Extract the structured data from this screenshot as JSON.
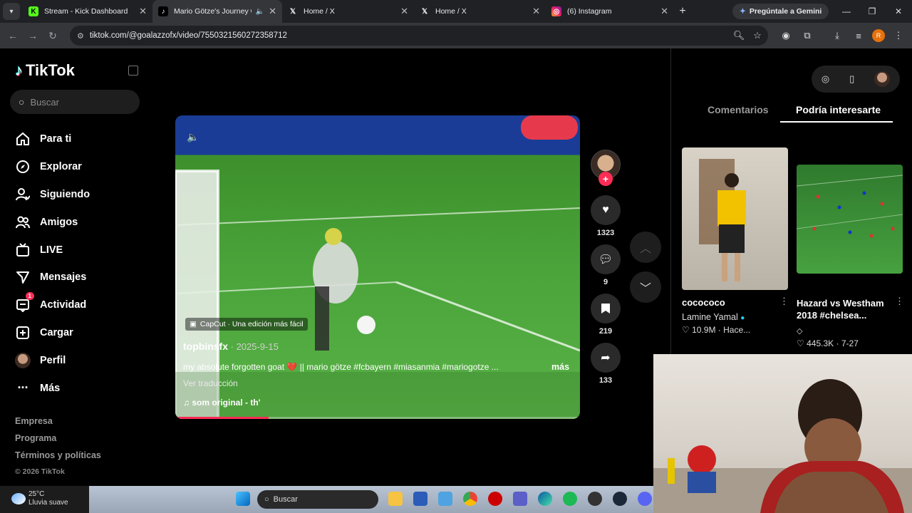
{
  "browser": {
    "tabs": [
      {
        "title": "Stream - Kick Dashboard",
        "icon": "kick-icon"
      },
      {
        "title": "Mario Götze's Journey wit",
        "icon": "tiktok-icon",
        "active": true
      },
      {
        "title": "Home / X",
        "icon": "x-icon"
      },
      {
        "title": "Home / X",
        "icon": "x-icon"
      },
      {
        "title": "(6) Instagram",
        "icon": "instagram-icon"
      }
    ],
    "gemini_label": "Pregúntale a Gemini",
    "url": "tiktok.com/@goalazzofx/video/7550321560272358712",
    "profile_initial": "R"
  },
  "sidebar": {
    "logo": "TikTok",
    "search_placeholder": "Buscar",
    "items": [
      {
        "label": "Para ti",
        "icon": "home-icon"
      },
      {
        "label": "Explorar",
        "icon": "compass-icon"
      },
      {
        "label": "Siguiendo",
        "icon": "following-icon"
      },
      {
        "label": "Amigos",
        "icon": "friends-icon"
      },
      {
        "label": "LIVE",
        "icon": "live-icon"
      },
      {
        "label": "Mensajes",
        "icon": "messages-icon"
      },
      {
        "label": "Actividad",
        "icon": "activity-icon",
        "badge": "1"
      },
      {
        "label": "Cargar",
        "icon": "upload-icon"
      },
      {
        "label": "Perfil",
        "icon": "avatar"
      },
      {
        "label": "Más",
        "icon": "more-icon"
      }
    ],
    "footer": [
      "Empresa",
      "Programa",
      "Términos y políticas"
    ],
    "copyright": "© 2026 TikTok"
  },
  "video": {
    "capcut": "CapCut · Una edición más fácil",
    "author": "topbinsfx",
    "date": "2025-9-15",
    "description": "my absolute forgotten goat 💔 || mario götze #fcbayern #miasanmia #mariogotze ...",
    "more": "más",
    "translate": "Ver traducción",
    "sound": "som original - th'",
    "progress": 0.23
  },
  "actions": {
    "likes": "1323",
    "comments": "9",
    "saves": "219",
    "shares": "133"
  },
  "right_panel": {
    "tab_comments": "Comentarios",
    "tab_interest": "Podría interesarte",
    "cards": [
      {
        "title": "cocococo",
        "author": "Lamine Yamal",
        "verified": true,
        "views": "10.9M",
        "time": "Hace..."
      },
      {
        "title": "Hazard vs Westham 2018 #chelsea...",
        "author": "◇",
        "views": "445.3K",
        "time": "7-27"
      }
    ]
  },
  "taskbar": {
    "temp": "25°C",
    "weather": "Lluvia suave",
    "search": "Buscar"
  },
  "colors": {
    "accent": "#fe2c55",
    "bg": "#000000"
  }
}
